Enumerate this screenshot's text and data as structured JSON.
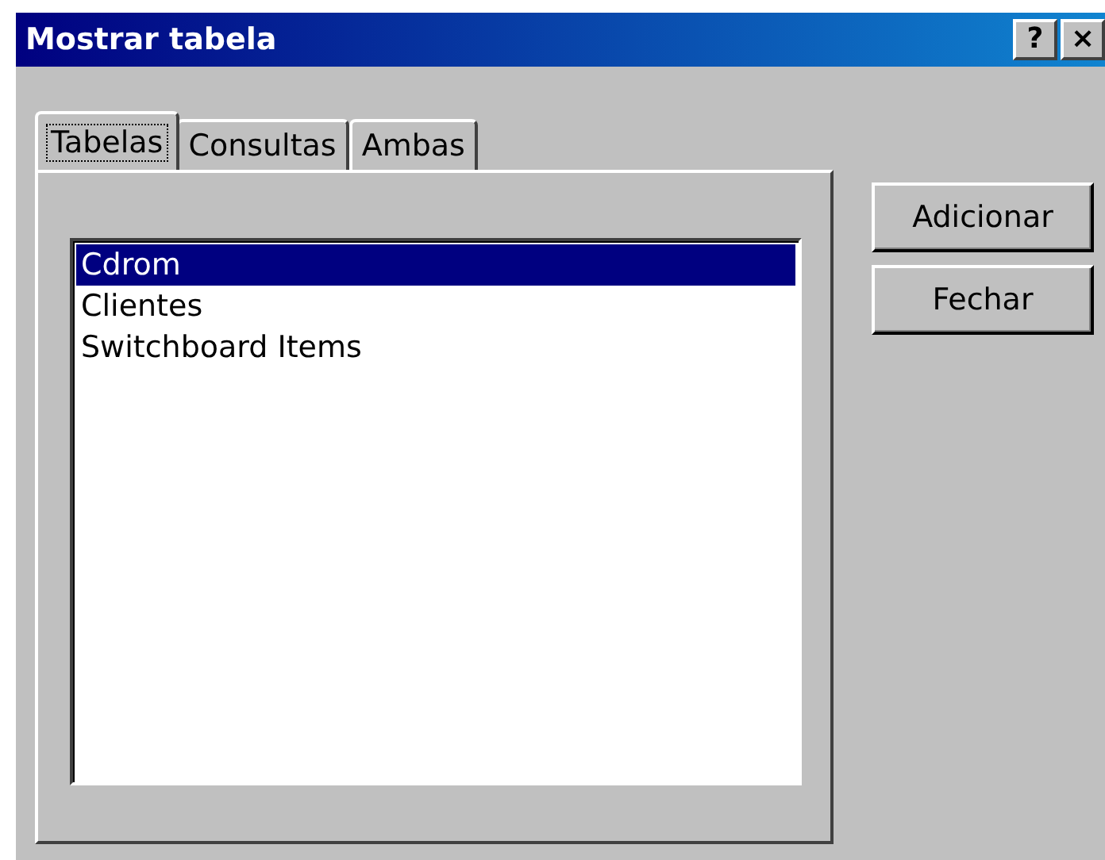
{
  "window": {
    "title": "Mostrar tabela",
    "title_buttons": [
      "?",
      "×"
    ]
  },
  "tabs": [
    {
      "label": "Tabelas",
      "selected": true
    },
    {
      "label": "Consultas",
      "selected": false
    },
    {
      "label": "Ambas",
      "selected": false
    }
  ],
  "list_items": [
    {
      "label": "Cdrom",
      "selected": true
    },
    {
      "label": "Clientes",
      "selected": false
    },
    {
      "label": "Switchboard Items",
      "selected": false
    }
  ],
  "buttons": [
    "Adicionar",
    "Fechar"
  ]
}
